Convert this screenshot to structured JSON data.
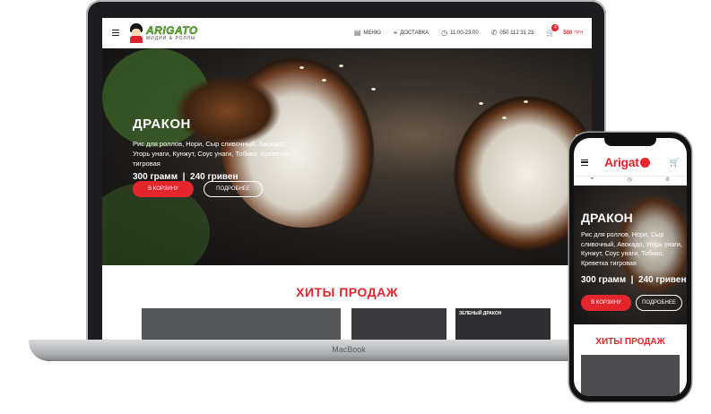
{
  "laptop": {
    "brand": "MacBook",
    "header": {
      "logo_name": "ARIGATO",
      "logo_sub": "МИДИИ & РОЛЛЫ",
      "nav": [
        {
          "icon": "menu-book-icon",
          "label": "МЕНЮ"
        },
        {
          "icon": "location-pin-icon",
          "label": "ДОСТАВКА"
        },
        {
          "icon": "clock-icon",
          "label": "11:00-23:00"
        },
        {
          "icon": "phone-icon",
          "label": "050 112 31 23"
        }
      ],
      "cart": {
        "count": "4",
        "sum": "500",
        "currency": "ГРН"
      }
    },
    "hero": {
      "title": "ДРАКОН",
      "ingredients": "Рис для роллов, Нори, Сыр сливочный, Авокадо, Угорь унаги, Кунжут, Соус унаги, Тобико, Креветка тигровая",
      "meta": "300 грамм  |  240 гривен",
      "cart_button": "В КОРЗИНУ",
      "details_button": "ПОДРОБНЕЕ"
    },
    "hits": {
      "title": "ХИТЫ ПРОДАЖ",
      "card_label": "ЗЕЛЕНЫЙ ДРАКОН"
    }
  },
  "phone": {
    "logo": "Arigat",
    "hero": {
      "title": "ДРАКОН",
      "ingredients": "Рис для роллов, Нори, Сыр сливочный, Авокадо, Угорь унаги, Кунжут, Соус унаги, Тобико, Креветка тигровая",
      "meta": "300 грамм  |  240 гривен",
      "cart_button": "В КОРЗИНУ",
      "details_button": "ПОДРОБНЕЕ"
    },
    "hits_title": "ХИТЫ ПРОДАЖ"
  },
  "colors": {
    "accent": "#e5252c",
    "logo_green": "#69b62f",
    "device": "#1d1d1f"
  }
}
